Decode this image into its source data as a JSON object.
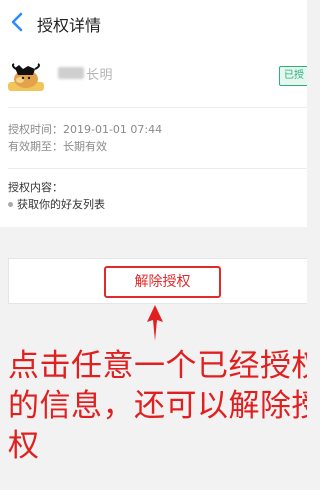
{
  "header": {
    "title": "授权详情"
  },
  "app": {
    "name_visible": "长明",
    "status_badge": "已授"
  },
  "timing": {
    "auth_time": "授权时间：2019-01-01 07:44",
    "validity": "有效期至：长期有效"
  },
  "permissions": {
    "title": "授权内容：",
    "items": [
      "获取你的好友列表"
    ]
  },
  "actions": {
    "revoke_label": "解除授权"
  },
  "annotation": {
    "text": "点击任意一个已经授权的信息，还可以解除授权"
  },
  "colors": {
    "accent_red": "#e02b2b",
    "badge_green": "#2ab07f"
  },
  "icons": {
    "back": "back-chevron-icon",
    "app": "cow-app-icon",
    "arrow": "up-arrow-icon"
  }
}
